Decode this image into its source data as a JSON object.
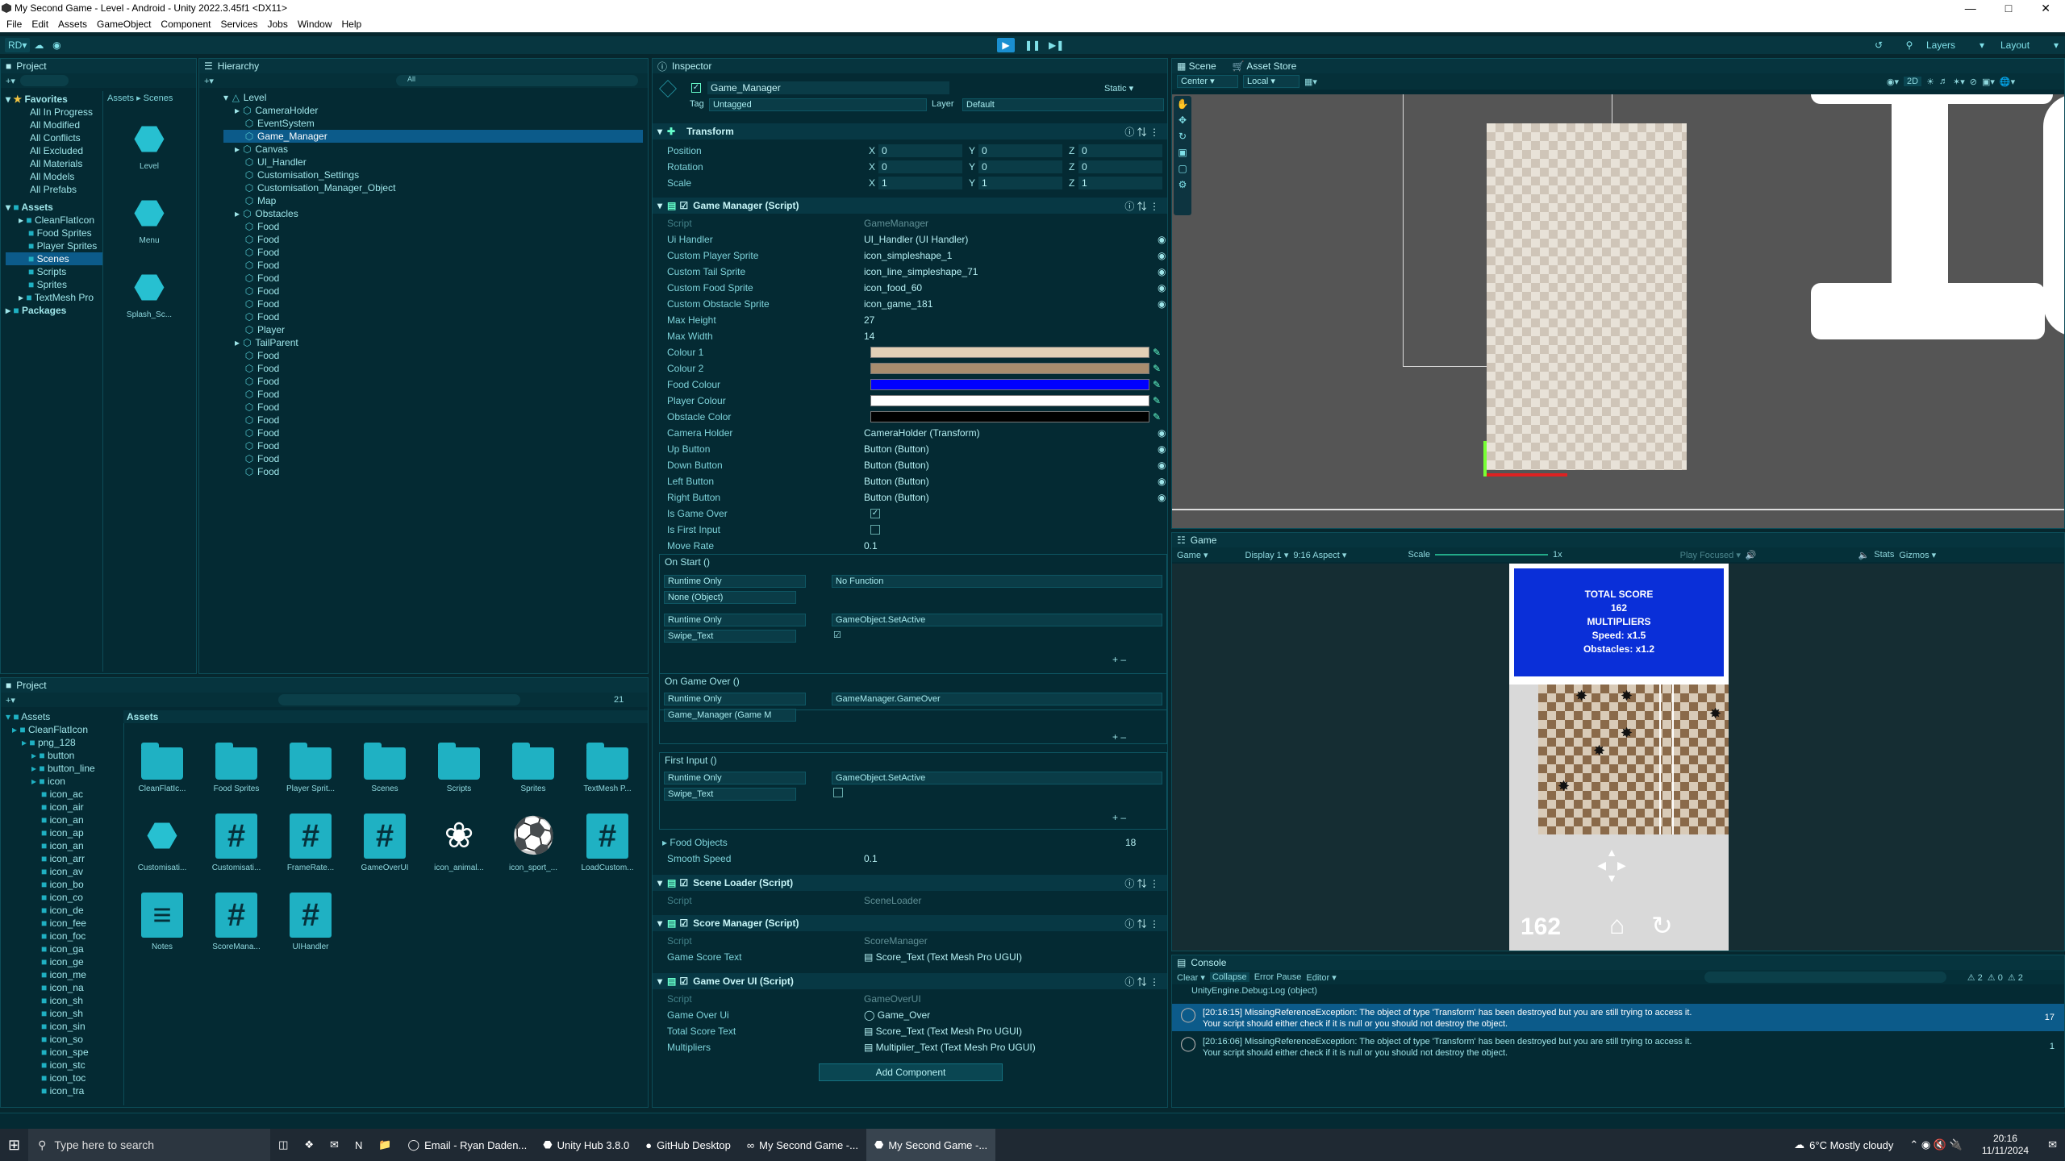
{
  "window": {
    "title": "My Second Game - Level - Android - Unity 2022.3.45f1 <DX11>"
  },
  "menu": [
    "File",
    "Edit",
    "Assets",
    "GameObject",
    "Component",
    "Services",
    "Jobs",
    "Window",
    "Help"
  ],
  "toolbar": {
    "account": "RD",
    "layers": "Layers",
    "layout": "Layout"
  },
  "project_top": {
    "tab": "Project",
    "breadcrumb_assets": "Assets",
    "breadcrumb_scenes": "Scenes",
    "favorites_label": "Favorites",
    "favorites": [
      "All In Progress",
      "All Modified",
      "All Conflicts",
      "All Excluded",
      "All Materials",
      "All Models",
      "All Prefabs"
    ],
    "assets_label": "Assets",
    "asset_folders": [
      "CleanFlatIcon",
      "Food Sprites",
      "Player Sprites",
      "Scenes",
      "Scripts",
      "Sprites",
      "TextMesh Pro"
    ],
    "packages_label": "Packages",
    "scene_assets": [
      "Level",
      "Menu",
      "Splash_Sc..."
    ]
  },
  "hierarchy": {
    "tab": "Hierarchy",
    "search_placeholder": "All",
    "root": "Level",
    "items": [
      "CameraHolder",
      "EventSystem",
      "Game_Manager",
      "Canvas",
      "UI_Handler",
      "Customisation_Settings",
      "Customisation_Manager_Object",
      "Map",
      "Obstacles",
      "Food",
      "Food",
      "Food",
      "Food",
      "Food",
      "Food",
      "Food",
      "Food",
      "Player",
      "TailParent",
      "Food",
      "Food",
      "Food",
      "Food",
      "Food",
      "Food",
      "Food",
      "Food",
      "Food",
      "Food"
    ]
  },
  "project_bottom": {
    "tab": "Project",
    "tree_assets": "Assets",
    "tree": [
      "CleanFlatIcon",
      "png_128",
      "button",
      "button_line",
      "icon",
      "icon_ac",
      "icon_air",
      "icon_an",
      "icon_ap",
      "icon_an",
      "icon_arr",
      "icon_av",
      "icon_bo",
      "icon_co",
      "icon_de",
      "icon_fee",
      "icon_foc",
      "icon_ga",
      "icon_ge",
      "icon_me",
      "icon_na",
      "icon_sh",
      "icon_sh",
      "icon_sin",
      "icon_so",
      "icon_spe",
      "icon_stc",
      "icon_toc",
      "icon_tra"
    ],
    "assets_header": "Assets",
    "count_badge": "21",
    "assets": [
      "CleanFlatIc...",
      "Food Sprites",
      "Player Sprit...",
      "Scenes",
      "Scripts",
      "Sprites",
      "TextMesh P...",
      "Customisati...",
      "Customisati...",
      "FrameRate...",
      "GameOverUI",
      "icon_animal...",
      "icon_sport_...",
      "LoadCustom...",
      "Notes",
      "ScoreMana...",
      "UIHandler"
    ]
  },
  "inspector": {
    "tab": "Inspector",
    "object_name": "Game_Manager",
    "static_label": "Static",
    "tag_label": "Tag",
    "tag_value": "Untagged",
    "layer_label": "Layer",
    "layer_value": "Default",
    "transform": {
      "title": "Transform",
      "position": "Position",
      "rotation": "Rotation",
      "scale": "Scale",
      "pos": [
        "0",
        "0",
        "0"
      ],
      "rot": [
        "0",
        "0",
        "0"
      ],
      "scl": [
        "1",
        "1",
        "1"
      ]
    },
    "game_manager": {
      "title": "Game Manager (Script)",
      "script_label": "Script",
      "script_value": "GameManager",
      "fields": [
        {
          "label": "Ui Handler",
          "value": "UI_Handler (UI Handler)"
        },
        {
          "label": "Custom Player Sprite",
          "value": "icon_simpleshape_1"
        },
        {
          "label": "Custom Tail Sprite",
          "value": "icon_line_simpleshape_71"
        },
        {
          "label": "Custom Food Sprite",
          "value": "icon_food_60"
        },
        {
          "label": "Custom Obstacle Sprite",
          "value": "icon_game_181"
        },
        {
          "label": "Max Height",
          "value": "27"
        },
        {
          "label": "Max Width",
          "value": "14"
        }
      ],
      "colors": [
        {
          "label": "Colour 1",
          "color": "#e2cfb6"
        },
        {
          "label": "Colour 2",
          "color": "#a88c6e"
        },
        {
          "label": "Food Colour",
          "color": "#0000ff"
        },
        {
          "label": "Player Colour",
          "color": "#ffffff"
        },
        {
          "label": "Obstacle Color",
          "color": "#000000"
        }
      ],
      "fields2": [
        {
          "label": "Camera Holder",
          "value": "CameraHolder (Transform)"
        },
        {
          "label": "Up Button",
          "value": "Button (Button)"
        },
        {
          "label": "Down Button",
          "value": "Button (Button)"
        },
        {
          "label": "Left Button",
          "value": "Button (Button)"
        },
        {
          "label": "Right Button",
          "value": "Button (Button)"
        }
      ],
      "is_game_over": "Is Game Over",
      "is_first_input": "Is First Input",
      "move_rate_label": "Move Rate",
      "move_rate": "0.1",
      "on_start": "On Start ()",
      "runtime_only": "Runtime Only",
      "no_function": "No Function",
      "none_object": "None (Object)",
      "setactive": "GameObject.SetActive",
      "swipe_text": "Swipe_Text",
      "on_game_over": "On Game Over ()",
      "gm_gameover": "GameManager.GameOver",
      "gm_field": "Game_Manager (Game M",
      "first_input": "First Input ()",
      "food_objects": "Food Objects",
      "food_count": "18",
      "smooth_speed_label": "Smooth Speed",
      "smooth_speed": "0.1"
    },
    "scene_loader": {
      "title": "Scene Loader (Script)",
      "script_label": "Script",
      "script_value": "SceneLoader"
    },
    "score_manager": {
      "title": "Score Manager (Script)",
      "script_label": "Script",
      "script_value": "ScoreManager",
      "field_label": "Game Score Text",
      "field_value": "Score_Text (Text Mesh Pro UGUI)"
    },
    "game_over_ui": {
      "title": "Game Over UI (Script)",
      "script_label": "Script",
      "script_value": "GameOverUI",
      "f1": "Game Over Ui",
      "v1": "Game_Over",
      "f2": "Total Score Text",
      "v2": "Score_Text (Text Mesh Pro UGUI)",
      "f3": "Multipliers",
      "v3": "Multiplier_Text (Text Mesh Pro UGUI)"
    },
    "add_component": "Add Component"
  },
  "scene_view": {
    "tab": "Scene",
    "tab2": "Asset Store",
    "center": "Center",
    "local": "Local",
    "mode2d": "2D"
  },
  "game_view": {
    "tab": "Game",
    "mode": "Game",
    "display": "Display 1",
    "aspect": "9:16 Aspect",
    "scale_label": "Scale",
    "scale_value": "1x",
    "play_focused": "Play Focused",
    "stats": "Stats",
    "gizmos": "Gizmos",
    "total_score_label": "TOTAL SCORE",
    "total_score": "162",
    "multipliers_label": "MULTIPLIERS",
    "speed": "Speed: x1.5",
    "obstacles": "Obstacles: x1.2",
    "score_bottom": "162"
  },
  "console": {
    "tab": "Console",
    "clear": "Clear",
    "collapse": "Collapse",
    "error_pause": "Error Pause",
    "editor": "Editor",
    "badge_warn": "2",
    "badge_info": "0",
    "badge_err": "2",
    "first_line": "UnityEngine.Debug:Log (object)",
    "entries": [
      {
        "line1": "[20:16:15] MissingReferenceException: The object of type 'Transform' has been destroyed but you are still trying to access it.",
        "line2": "Your script should either check if it is null or you should not destroy the object.",
        "count": "17"
      },
      {
        "line1": "[20:16:06] MissingReferenceException: The object of type 'Transform' has been destroyed but you are still trying to access it.",
        "line2": "Your script should either check if it is null or you should not destroy the object.",
        "count": "1"
      }
    ]
  },
  "taskbar": {
    "search": "Type here to search",
    "items": [
      "Email - Ryan Daden...",
      "Unity Hub 3.8.0",
      "GitHub Desktop",
      "My Second Game -...",
      "My Second Game -..."
    ],
    "weather": "6°C  Mostly cloudy",
    "time": "20:16",
    "date": "11/11/2024"
  }
}
